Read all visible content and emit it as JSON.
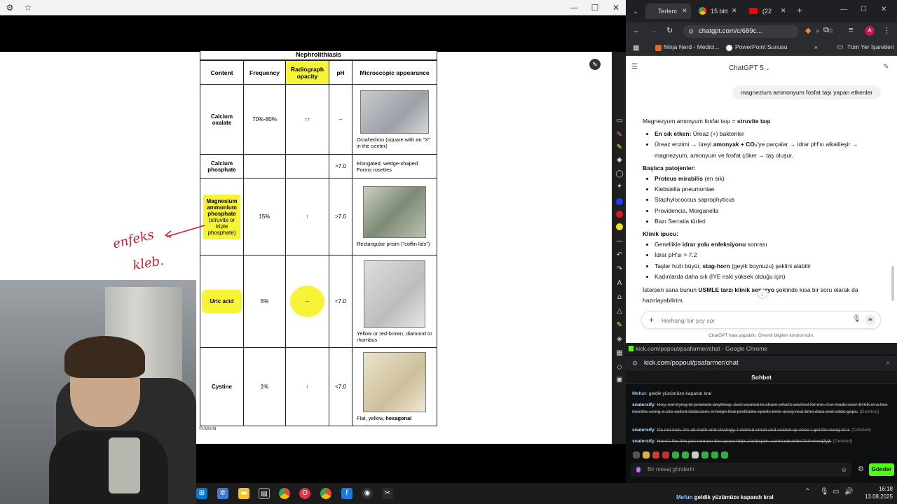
{
  "whiteboard": {
    "table_title": "Nephrolithiasis",
    "headers": [
      "Content",
      "Frequency",
      "Radiograph opacity",
      "pH",
      "Microscopic appearance"
    ],
    "rows": [
      {
        "content": "Calcium oxalate",
        "sub": "",
        "frequency": "70%-80%",
        "opacity": "↑↑",
        "ph": "--",
        "appearance": "Octahedron (square with an \"X\" in the center)"
      },
      {
        "content": "Calcium phosphate",
        "sub": "",
        "frequency": "",
        "opacity": "",
        "ph": ">7.0",
        "appearance": "Elongated, wedge-shaped\nForms rosettes"
      },
      {
        "content": "Magnesium ammonium phosphate",
        "sub": "(struvite or triple phosphate)",
        "frequency": "15%",
        "opacity": "↑",
        "ph": ">7.0",
        "appearance": "Rectangular prism (\"coffin lids\")"
      },
      {
        "content": "Uric acid",
        "sub": "",
        "frequency": "5%",
        "opacity": "--",
        "ph": "<7.0",
        "appearance": "Yellow or red-brown, diamond or rhombus"
      },
      {
        "content": "Cystine",
        "sub": "",
        "frequency": "1%",
        "opacity": "↑",
        "ph": "<7.0",
        "appearance_pre": "Flat, yellow, ",
        "appearance_bold": "hexagonal"
      }
    ],
    "handwriting_line1": "enfeks",
    "handwriting_line2": "kleb.",
    "credit": "©UWorld"
  },
  "chrome": {
    "tabs": [
      {
        "label": "Terlem",
        "active": true
      },
      {
        "label": "15 bitt",
        "active": false
      },
      {
        "label": "(22",
        "active": false
      }
    ],
    "url": "chatgpt.com/c/689c...",
    "bookmarks": [
      "Ninja Nerd - Medici...",
      "PowerPoint Sunusu",
      "Tüm Yer İşaretleri"
    ],
    "model": "ChatGPT 5",
    "user_message": "magnezium ammonyum fosfat taşı yapan etkenler",
    "answer": {
      "intro_pre": "Magnezyum amonyum fosfat taşı = ",
      "intro_bold": "struvite taşı",
      "bullets1": [
        {
          "bold": "En sık etken:",
          "text": " Üreaz (+) bakteriler"
        },
        {
          "bold": "",
          "text": "Üreaz enzimi → üreyi ",
          "bold2": "amonyak + CO₂",
          "text2": "'ye parçalar → idrar pH'sı alkalileşir → magnezyum, amonyum ve fosfat çöker → taş oluşur."
        }
      ],
      "heading2": "Başlıca patojenler:",
      "pathogens": [
        {
          "bold": "Proteus mirabilis",
          "text": " (en sık)"
        },
        {
          "bold": "",
          "text": "Klebsiella pneumoniae"
        },
        {
          "bold": "",
          "text": "Staphylococcus saprophyticus"
        },
        {
          "bold": "",
          "text": "Providencia, Morganella"
        },
        {
          "bold": "",
          "text": "Bazı Serratia türleri"
        }
      ],
      "heading3": "Klinik ipucu:",
      "tips": [
        {
          "pre": "Genellikle ",
          "bold": "idrar yolu enfeksiyonu",
          "post": " sonrası"
        },
        {
          "pre": "İdrar pH'sı > 7.2",
          "bold": "",
          "post": ""
        },
        {
          "pre": "Taşlar hızlı büyür, ",
          "bold": "stag-horn",
          "post": " (geyik boynuzu) şeklini alabilir"
        },
        {
          "pre": "Kadınlarda daha sık (İYE riski yüksek olduğu için)",
          "bold": "",
          "post": ""
        }
      ],
      "closing_pre": "İstersen sana bunun ",
      "closing_bold": "USMLE tarzı klinik senaryo",
      "closing_post": " şeklinde kısa bir soru olarak da hazırlayabilirim."
    },
    "input_placeholder": "Herhangi bir şey sor",
    "footer_note": "ChatGPT hata yapabilir. Önemli bilgileri kontrol edin."
  },
  "kick": {
    "window_title": "kick.com/popout/psafarmer/chat - Google Chrome",
    "url": "kick.com/popout/psafarmer/chat",
    "header": "Sohbet",
    "messages": [
      {
        "user": "Mefun",
        "text": ": geldik yüzümüze kapandı kral",
        "deleted": false,
        "user_color": "#8fc1ff"
      },
      {
        "user": "snalersify",
        "text": "Hey, not trying to promote anything. Just wanted to share what's worked for me. I've made over $40K in a few months using a site called OddsJam. It helps find profitable sports bets using real-time data and odds gaps.",
        "deleted": true,
        "user_color": "#b6e3ff"
      },
      {
        "user": "snalersify",
        "text": "It's not luck. It's all math and strategy. I started small and scaled up once I got the hang of it.",
        "deleted": true,
        "user_color": "#b6e3ff"
      },
      {
        "user": "snalersify",
        "text": "Here's the link just remove the space https://oddsjam .com/subscribe?ref=mwq3yjk",
        "deleted": true,
        "user_color": "#b6e3ff"
      }
    ],
    "deleted_tag": "(Deleted)",
    "input_placeholder": "Bir mesaj gönderin",
    "send_label": "Gönder"
  },
  "taskbar": {
    "time": "16:18",
    "date": "13.08.2025",
    "ticker_user": "Mefun",
    "ticker_text": " geldik yüzümüze kapandı kral"
  },
  "colors": {
    "highlight": "#f7f336",
    "kick_green": "#53fc18",
    "chrome_dark": "#1f2023"
  }
}
